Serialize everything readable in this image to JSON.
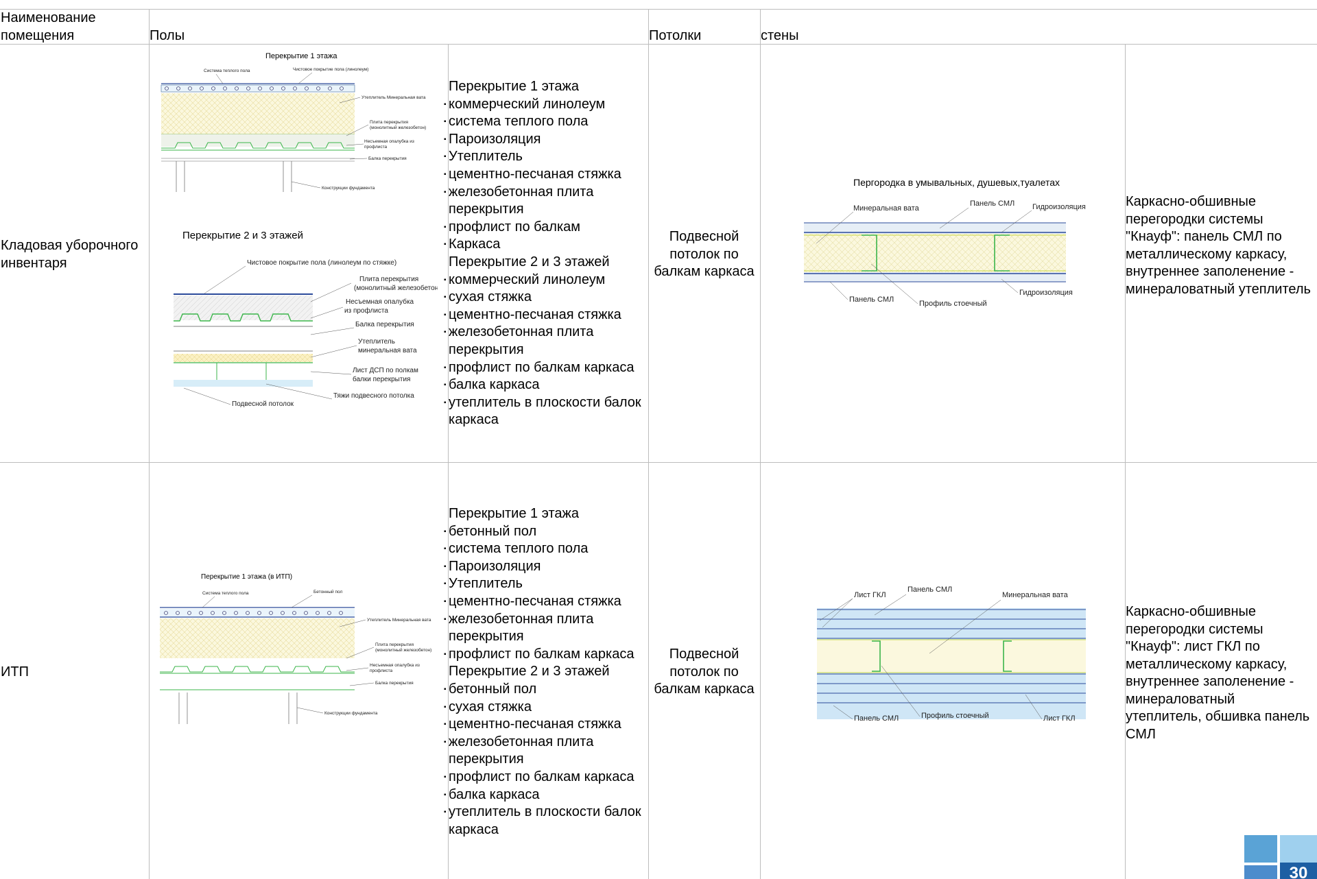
{
  "header": {
    "room_name": "Наименование помещения",
    "floors": "Полы",
    "ceilings": "Потолки",
    "walls": "стены"
  },
  "rows": [
    {
      "room": "Кладовая уборочного инвентаря",
      "floor_list": [
        {
          "text": "Перекрытие 1 этажа",
          "bullet": false
        },
        {
          "text": "коммерческий линолеум",
          "bullet": true
        },
        {
          "text": "система теплого пола",
          "bullet": true
        },
        {
          "text": "Пароизоляция",
          "bullet": true
        },
        {
          "text": "Утеплитель",
          "bullet": true
        },
        {
          "text": "цементно-песчаная стяжка",
          "bullet": true
        },
        {
          "text": "железобетонная плита перекрытия",
          "bullet": true
        },
        {
          "text": "профлист по балкам",
          "bullet": true
        },
        {
          "text": "Каркаса",
          "bullet": true
        },
        {
          "text": "Перекрытие 2 и 3 этажей",
          "bullet": false
        },
        {
          "text": "коммерческий линолеум",
          "bullet": true
        },
        {
          "text": "сухая стяжка",
          "bullet": true
        },
        {
          "text": "цементно-песчаная стяжка",
          "bullet": true
        },
        {
          "text": "железобетонная плита перекрытия",
          "bullet": true
        },
        {
          "text": "профлист по балкам каркаса",
          "bullet": true
        },
        {
          "text": "балка каркаса",
          "bullet": true
        },
        {
          "text": "утеплитель в плоскости балок каркаса",
          "bullet": true
        }
      ],
      "ceiling": "Подвесной потолок по балкам каркаса",
      "walls": "Каркасно-обшивные перегородки системы \"Кнауф\": панель СМЛ по металлическому каркасу, внутреннее заполенение - минераловатный утеплитель",
      "drawing1": {
        "title": "Перекрытие 1 этажа",
        "labels": [
          "Система теплого пола",
          "Чистовое покрытие пола (линолеум)",
          "Утеплитель Минеральная вата",
          "Плита перекрытия",
          "(монолитный железобетон)",
          "Несъемная опалубка из",
          "профлиста",
          "Балка перекрытия",
          "Конструкции фундамента"
        ]
      },
      "drawing2": {
        "title": "Перекрытие 2 и 3 этажей",
        "labels": [
          "Чистовое покрытие пола (линолеум по стяжке)",
          "Плита перекрытия",
          "(монолитный железобетон)",
          "Несъемная опалубка",
          "из профлиста",
          "Балка перекрытия",
          "Утеплитель",
          "минеральная вата",
          "Лист ДСП по полкам",
          "балки перекрытия",
          "Тяжи подвесного потолка",
          "Подвесной потолок"
        ]
      },
      "wall_drawing": {
        "title": "Пергородка в умывальных, душевых,туалетах",
        "labels": [
          "Минеральная вата",
          "Панель СМЛ",
          "Гидроизоляция",
          "Панель СМЛ",
          "Профиль стоечный",
          "Гидроизоляция"
        ]
      }
    },
    {
      "room": "ИТП",
      "floor_list": [
        {
          "text": "Перекрытие 1 этажа",
          "bullet": false
        },
        {
          "text": "бетонный пол",
          "bullet": true
        },
        {
          "text": "система теплого пола",
          "bullet": true
        },
        {
          "text": "Пароизоляция",
          "bullet": true
        },
        {
          "text": "Утеплитель",
          "bullet": true
        },
        {
          "text": "цементно-песчаная стяжка",
          "bullet": true
        },
        {
          "text": "железобетонная плита перекрытия",
          "bullet": true
        },
        {
          "text": "профлист по балкам каркаса",
          "bullet": true
        },
        {
          "text": "Перекрытие 2 и 3 этажей",
          "bullet": false
        },
        {
          "text": "бетонный пол",
          "bullet": true
        },
        {
          "text": "сухая стяжка",
          "bullet": true
        },
        {
          "text": "цементно-песчаная стяжка",
          "bullet": true
        },
        {
          "text": "железобетонная плита перекрытия",
          "bullet": true
        },
        {
          "text": "профлист по балкам каркаса",
          "bullet": true
        },
        {
          "text": "балка каркаса",
          "bullet": true
        },
        {
          "text": "утеплитель в плоскости балок каркаса",
          "bullet": true
        }
      ],
      "ceiling": "Подвесной потолок по балкам каркаса",
      "walls": "Каркасно-обшивные перегородки системы \"Кнауф\": лист ГКЛ по металлическому каркасу, внутреннее заполенение - минераловатный утеплитель, обшивка панель СМЛ",
      "drawing1": {
        "title": "Перекрытие 1 этажа (в ИТП)",
        "labels": [
          "Система теплого пола",
          "Бетонный пол",
          "Утеплитель Минеральная вата",
          "Плита перекрытия",
          "(монолитный железобетон)",
          "Несъемная опалубка из",
          "профлиста",
          "Балка перекрытия",
          "Конструкции фундамента"
        ]
      },
      "wall_drawing": {
        "labels": [
          "Лист ГКЛ",
          "Панель СМЛ",
          "Минеральная вата",
          "Панель СМЛ",
          "Профиль стоечный",
          "Лист ГКЛ"
        ]
      }
    }
  ],
  "page_number": "30",
  "colors": {
    "accent": "#5aa3d6",
    "accent_light": "#9fd0ee",
    "grid": "#bdbdbd"
  }
}
